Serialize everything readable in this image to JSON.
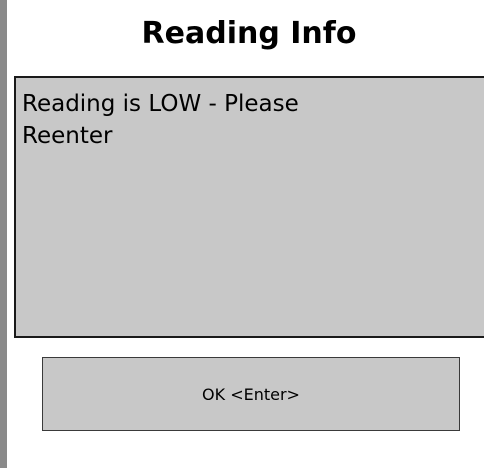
{
  "dialog": {
    "title": "Reading Info",
    "message": "Reading is LOW - Please\nReenter",
    "ok_label": "OK <Enter>"
  },
  "colors": {
    "panel_background": "#c8c8c8",
    "page_background": "#ffffff",
    "left_bar": "#8a8a8a"
  }
}
